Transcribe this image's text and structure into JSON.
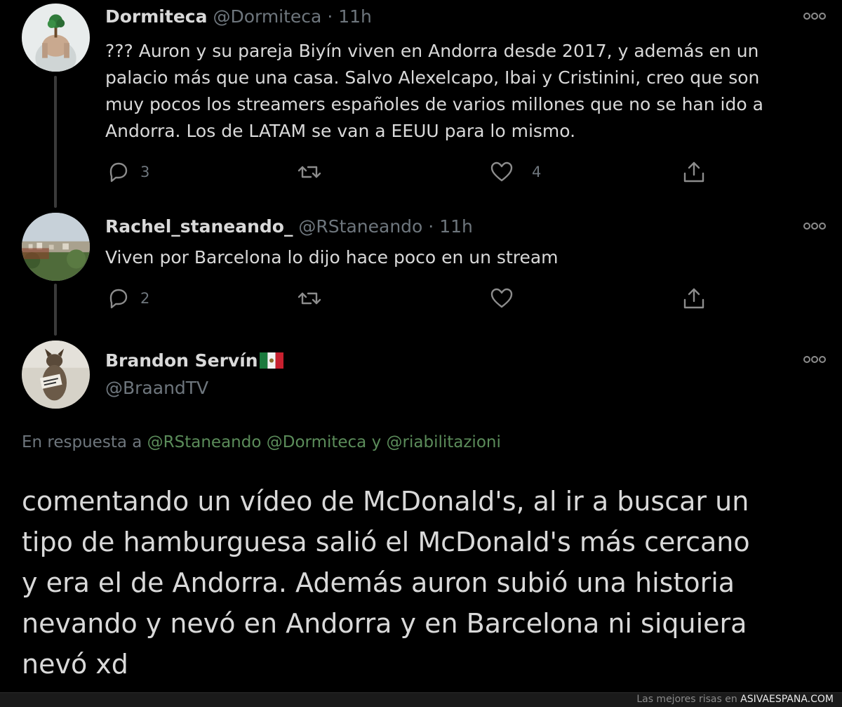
{
  "tweets": [
    {
      "name": "Dormiteca",
      "handle": "@Dormiteca",
      "separator": "·",
      "time": "11h",
      "text_lines": [
        "??? Auron y su pareja Biyín viven en Andorra desde 2017, y además en un",
        "palacio más que una casa. Salvo Alexelcapo, Ibai y Cristinini, creo que son",
        "muy pocos los streamers españoles de varios millones que no se han ido a",
        "Andorra. Los de LATAM se van a EEUU para lo mismo."
      ],
      "reply_count": "3",
      "retweet_count": "",
      "like_count": "4"
    },
    {
      "name": "Rachel_staneando_",
      "handle": "@RStaneando",
      "separator": "·",
      "time": "11h",
      "text_lines": [
        "Viven por Barcelona lo dijo hace poco en un stream"
      ],
      "reply_count": "2",
      "retweet_count": "",
      "like_count": ""
    }
  ],
  "main_tweet": {
    "name": "Brandon Servín",
    "handle": "@BraandTV",
    "flag_icon": "mexico-flag-icon",
    "reply_prefix": "En respuesta a",
    "mention_1": "@RStaneando",
    "mention_2": "@Dormiteca",
    "mention_joiner": "y",
    "mention_3": "@riabilitazioni",
    "text_lines": [
      "comentando un vídeo de McDonald's, al ir a buscar un",
      "tipo de hamburguesa salió el McDonald's más cercano",
      "y era el de Andorra. Además auron subió una historia",
      "nevando y nevó en Andorra y en Barcelona ni siquiera",
      "nevó xd"
    ]
  },
  "footer": {
    "prefix": "Las mejores risas en",
    "brand": "ASIVAESPANA.COM"
  },
  "colors": {
    "background": "#000000",
    "text": "#d9d9d9",
    "muted": "#6e767d",
    "mention": "#5b8c5a",
    "thread_line": "#3a3a3a"
  }
}
